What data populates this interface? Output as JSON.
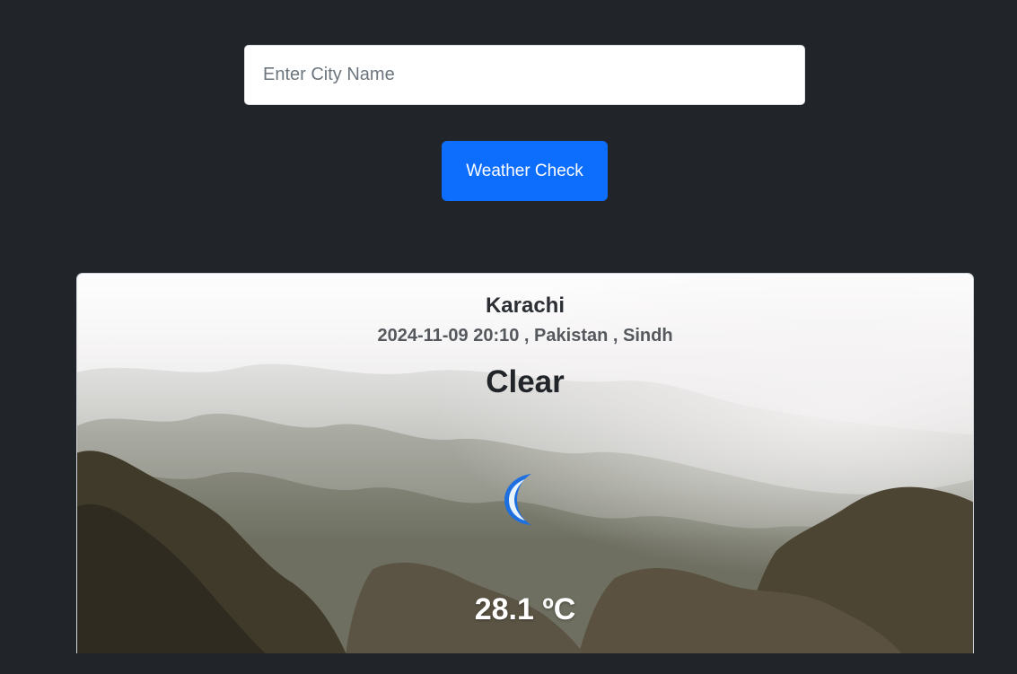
{
  "search": {
    "placeholder": "Enter City Name",
    "value": ""
  },
  "actions": {
    "check_label": "Weather Check"
  },
  "weather": {
    "city": "Karachi",
    "meta_line": "2024-11-09 20:10 , Pakistan , Sindh",
    "condition": "Clear",
    "icon": "crescent-moon-icon",
    "temperature": "28.1 ºC"
  },
  "colors": {
    "page_background": "#212529",
    "button_primary": "#0d6efd",
    "moon_fill": "#1e6fe0",
    "moon_highlight": "#e9f4ff"
  }
}
